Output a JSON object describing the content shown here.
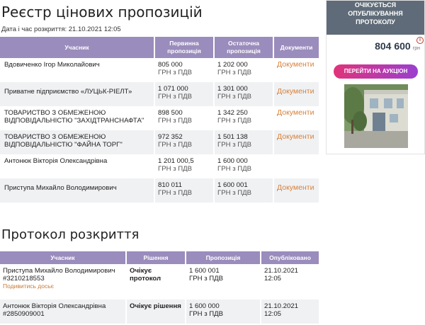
{
  "registry": {
    "title": "Реєстр цінових пропозицій",
    "date_label": "Дата і час розкриття: 21.10.2021 12:05",
    "headers": {
      "participant": "Учасник",
      "initial": "Первинна пропозиція",
      "final": "Остаточна пропозиція",
      "documents": "Документи"
    },
    "rows": [
      {
        "name": "Вдовиченко Ігор Миколайович",
        "initial_amount": "805 000",
        "initial_unit": "ГРН з ПДВ",
        "final_amount": "1 202 000",
        "final_unit": "ГРН з ПДВ",
        "docs": "Документи"
      },
      {
        "name": "Приватне підприємство «ЛУЦЬК-РІЕЛТ»",
        "initial_amount": "1 071 000",
        "initial_unit": "ГРН з ПДВ",
        "final_amount": "1 301 000",
        "final_unit": "ГРН з ПДВ",
        "docs": "Документи"
      },
      {
        "name": "ТОВАРИСТВО З ОБМЕЖЕНОЮ ВІДПОВІДАЛЬНІСТЮ \"ЗАХІДТРАНСНАФТА\"",
        "initial_amount": "898 500",
        "initial_unit": "ГРН з ПДВ",
        "final_amount": "1 342 250",
        "final_unit": "ГРН з ПДВ",
        "docs": "Документи"
      },
      {
        "name": "ТОВАРИСТВО З ОБМЕЖЕНОЮ ВІДПОВІДАЛЬНІСТЮ \"ФАЙНА ТОРГ\"",
        "initial_amount": "972 352",
        "initial_unit": "ГРН з ПДВ",
        "final_amount": "1 501 138",
        "final_unit": "ГРН з ПДВ",
        "docs": "Документи"
      },
      {
        "name": "Антонюк Вікторія Олександрівна",
        "initial_amount": "1 201 000,5",
        "initial_unit": "ГРН з ПДВ",
        "final_amount": "1 600 000",
        "final_unit": "ГРН з ПДВ",
        "docs": ""
      },
      {
        "name": "Приступа Михайло Володимирович",
        "initial_amount": "810 011",
        "initial_unit": "ГРН з ПДВ",
        "final_amount": "1 600 001",
        "final_unit": "ГРН з ПДВ",
        "docs": "Документи"
      }
    ]
  },
  "protocol": {
    "title": "Протокол розкриття",
    "headers": {
      "participant": "Учасник",
      "decision": "Рішення",
      "offer": "Пропозиція",
      "published": "Опубліковано"
    },
    "rows": [
      {
        "name": "Приступа Михайло Володимирович",
        "id": "#3210218553",
        "dossier": "Подивитись досьє",
        "decision": "Очікує протокол",
        "offer_amount": "1 600 001",
        "offer_unit": "ГРН з ПДВ",
        "published_date": "21.10.2021",
        "published_time": "12:05"
      },
      {
        "name": "Антонюк Вікторія Олександрівна",
        "id": "#2850909001",
        "dossier": "",
        "decision": "Очікує рішення",
        "offer_amount": "1 600 000",
        "offer_unit": "ГРН з ПДВ",
        "published_date": "21.10.2021",
        "published_time": "12:05"
      }
    ]
  },
  "sidebar": {
    "status_line1": "ОЧІКУЄТЬСЯ",
    "status_line2": "ОПУБЛІКУВАННЯ",
    "status_line3": "ПРОТОКОЛУ",
    "price": "804 600",
    "currency": "грн",
    "info_icon": "i",
    "auction_button": "ПЕРЕЙТИ НА АУКЦІОН"
  },
  "colors": {
    "header_purple": "#9a8cbc",
    "link_orange": "#d7813a",
    "status_gray": "#5f6b78",
    "button_pink": "#e0337a",
    "button_purple": "#9a3fd0"
  }
}
